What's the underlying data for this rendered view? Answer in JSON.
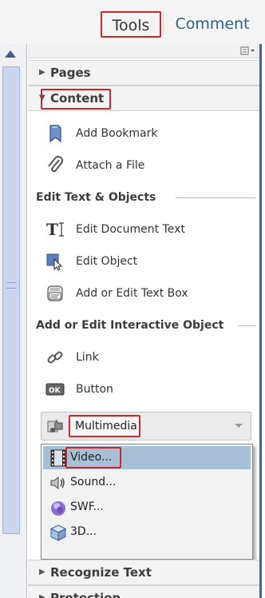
{
  "tabs": {
    "tools": "Tools",
    "comment": "Comment"
  },
  "panel": {
    "options_icon": "panel-options-icon",
    "sections": {
      "pages": "Pages",
      "content": "Content",
      "recognize_text": "Recognize Text",
      "protection": "Protection"
    },
    "content_items": [
      {
        "label": "Add Bookmark",
        "icon": "bookmark-icon"
      },
      {
        "label": "Attach a File",
        "icon": "paperclip-icon"
      }
    ],
    "edit_group": {
      "title": "Edit Text & Objects",
      "items": [
        {
          "label": "Edit Document Text",
          "icon": "text-cursor-icon"
        },
        {
          "label": "Edit Object",
          "icon": "object-pointer-icon"
        },
        {
          "label": "Add or Edit Text Box",
          "icon": "text-box-icon"
        }
      ]
    },
    "interactive_group": {
      "title": "Add or Edit Interactive Object",
      "items": [
        {
          "label": "Link",
          "icon": "link-icon"
        },
        {
          "label": "Button",
          "icon": "ok-button-icon"
        }
      ]
    },
    "multimedia": {
      "label": "Multimedia",
      "icon": "multimedia-icon"
    },
    "multimedia_menu": [
      {
        "label": "Video...",
        "icon": "film-icon",
        "selected": true
      },
      {
        "label": "Sound...",
        "icon": "speaker-icon"
      },
      {
        "label": "SWF...",
        "icon": "swf-icon"
      },
      {
        "label": "3D...",
        "icon": "3d-cube-icon"
      }
    ]
  },
  "colors": {
    "highlight_red": "#c8282d",
    "accent_blue": "#3b61b4",
    "menu_selection": "#a8c0d6"
  }
}
